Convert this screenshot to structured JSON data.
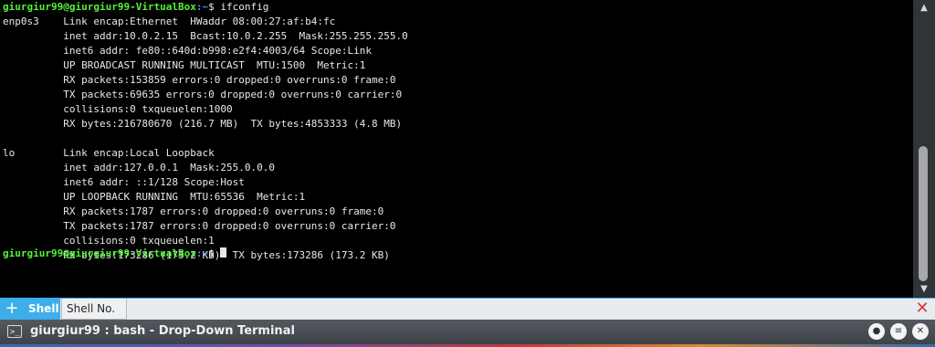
{
  "terminal": {
    "prompt_user": "giurgiur99@giurgiur99-VirtualBox",
    "prompt_path": ":~",
    "prompt_symbol": "$ ",
    "command": "ifconfig",
    "lines": [
      "enp0s3    Link encap:Ethernet  HWaddr 08:00:27:af:b4:fc",
      "          inet addr:10.0.2.15  Bcast:10.0.2.255  Mask:255.255.255.0",
      "          inet6 addr: fe80::640d:b998:e2f4:4003/64 Scope:Link",
      "          UP BROADCAST RUNNING MULTICAST  MTU:1500  Metric:1",
      "          RX packets:153859 errors:0 dropped:0 overruns:0 frame:0",
      "          TX packets:69635 errors:0 dropped:0 overruns:0 carrier:0",
      "          collisions:0 txqueuelen:1000",
      "          RX bytes:216780670 (216.7 MB)  TX bytes:4853333 (4.8 MB)",
      "",
      "lo        Link encap:Local Loopback",
      "          inet addr:127.0.0.1  Mask:255.0.0.0",
      "          inet6 addr: ::1/128 Scope:Host",
      "          UP LOOPBACK RUNNING  MTU:65536  Metric:1",
      "          RX packets:1787 errors:0 dropped:0 overruns:0 frame:0",
      "          TX packets:1787 errors:0 dropped:0 overruns:0 carrier:0",
      "          collisions:0 txqueuelen:1",
      "          RX bytes:173286 (173.2 KB)  TX bytes:173286 (173.2 KB)",
      ""
    ]
  },
  "tabs": {
    "new_tab_icon": "+",
    "items": [
      {
        "label": "Shell",
        "active": true
      },
      {
        "label": "Shell No. 2",
        "active": false
      }
    ],
    "close_icon": "✕"
  },
  "titlebar": {
    "app_icon": ">_",
    "title": "giurgiur99 : bash - Drop-Down Terminal",
    "pin_icon": "●",
    "menu_icon": "≡",
    "close_icon": "✕"
  },
  "colors": {
    "prompt_user": "#54f23a",
    "prompt_path": "#5a8cff",
    "accent": "#3daee9",
    "close_red": "#d63a3a"
  },
  "icons": [
    "terminal-icon",
    "new-tab-icon",
    "close-tab-icon",
    "pin-icon",
    "menu-icon",
    "close-icon",
    "scroll-up-icon",
    "scroll-down-icon"
  ]
}
